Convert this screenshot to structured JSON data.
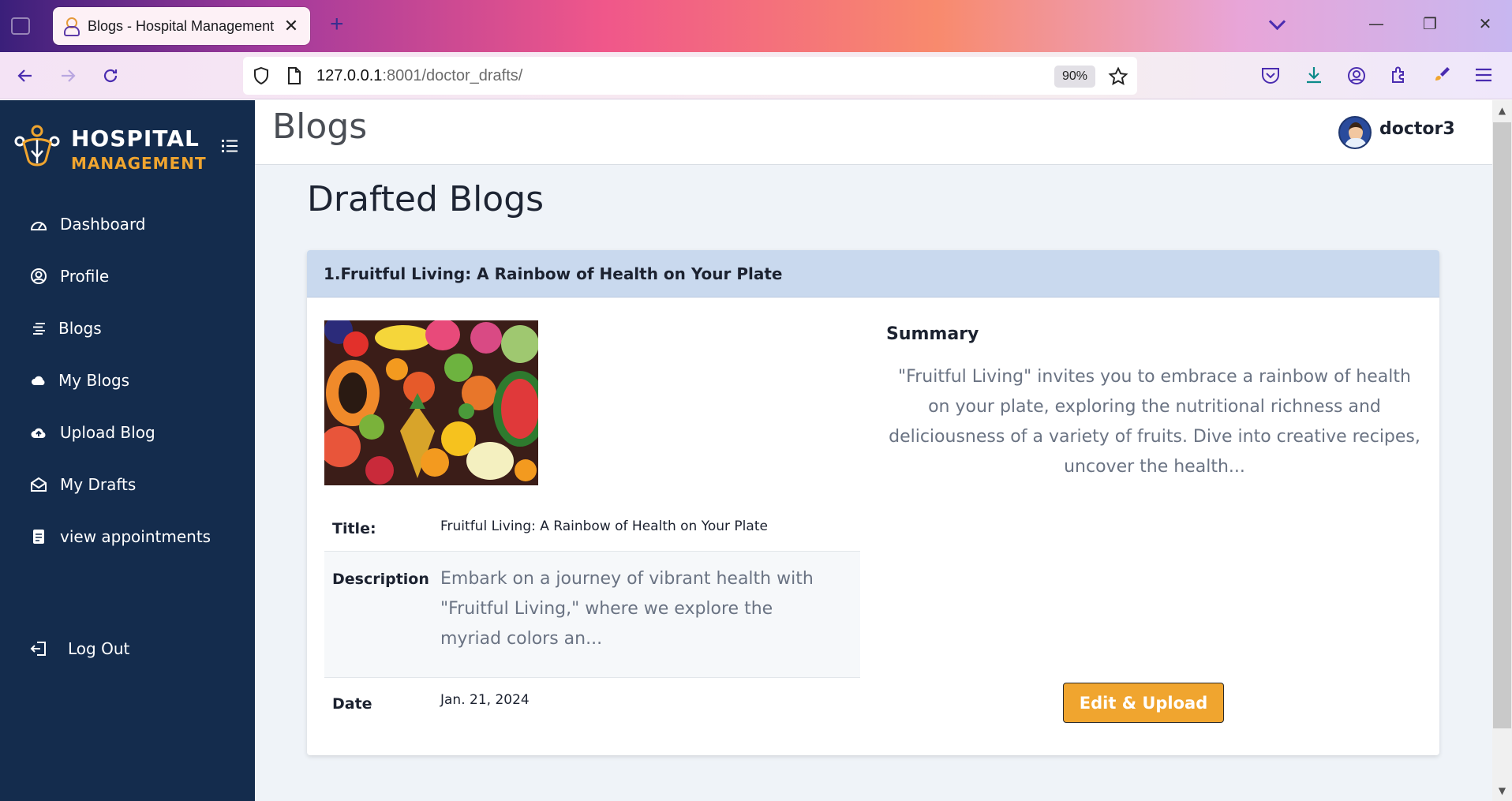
{
  "browser": {
    "tab_title": "Blogs - Hospital Management",
    "close_glyph": "✕",
    "new_tab_glyph": "+",
    "url_host": "127.0.0.1",
    "url_rest": ":8001/doctor_drafts/",
    "zoom": "90%",
    "window_controls": {
      "minimize": "—",
      "restore": "❐",
      "close": "✕"
    }
  },
  "brand": {
    "line1": "HOSPITAL",
    "line2": "MANAGEMENT",
    "accent_color": "#f0a52f"
  },
  "sidebar": {
    "items": [
      {
        "label": "Dashboard",
        "icon": "gauge-icon"
      },
      {
        "label": "Profile",
        "icon": "user-circle-icon"
      },
      {
        "label": "Blogs",
        "icon": "align-left-icon"
      },
      {
        "label": "My Blogs",
        "icon": "cloud-icon"
      },
      {
        "label": "Upload Blog",
        "icon": "cloud-upload-icon"
      },
      {
        "label": "My Drafts",
        "icon": "envelope-open-icon"
      },
      {
        "label": "view appointments",
        "icon": "file-icon"
      }
    ],
    "logout_label": "Log Out"
  },
  "header": {
    "title": "Blogs",
    "username": "doctor3"
  },
  "main": {
    "section_title": "Drafted Blogs",
    "blogs": [
      {
        "heading": "1.Fruitful Living: A Rainbow of Health on Your Plate",
        "title_label": "Title:",
        "title": "Fruitful Living: A Rainbow of Health on Your Plate",
        "description_label": "Description",
        "description": "Embark on a journey of vibrant health with \"Fruitful Living,\" where we explore the myriad colors an...",
        "date_label": "Date",
        "date": "Jan. 21, 2024",
        "summary_label": "Summary",
        "summary": "\"Fruitful Living\" invites you to embrace a rainbow of health on your plate, exploring the nutritional richness and deliciousness of a variety of fruits. Dive into creative recipes, uncover the health...",
        "button_label": "Edit & Upload"
      }
    ]
  },
  "colors": {
    "sidebar_bg": "#142c4d",
    "header_bg": "#c9d9ee",
    "button_bg": "#f0a52f",
    "main_bg": "#eff3f8"
  }
}
